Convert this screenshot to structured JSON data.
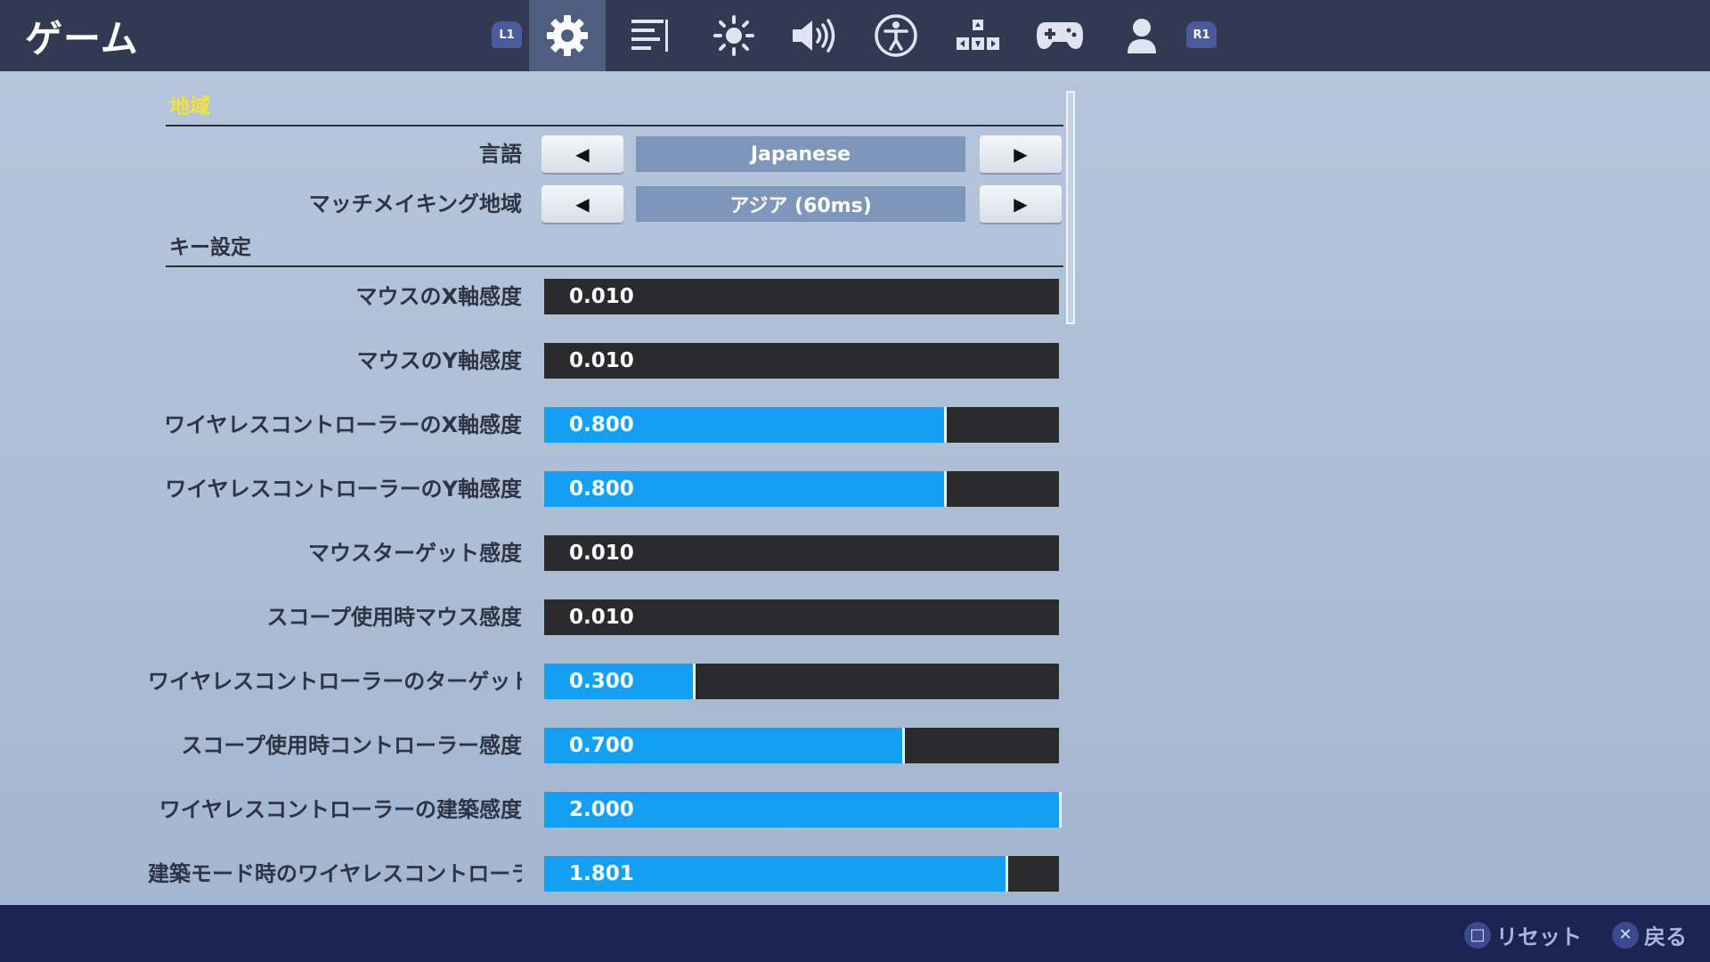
{
  "header": {
    "title": "ゲーム",
    "tabs": [
      {
        "icon": "l1-button-icon",
        "label": "L1"
      },
      {
        "icon": "gear-icon",
        "active": true
      },
      {
        "icon": "list-icon"
      },
      {
        "icon": "brightness-icon"
      },
      {
        "icon": "speaker-icon"
      },
      {
        "icon": "accessibility-icon"
      },
      {
        "icon": "input-keys-icon"
      },
      {
        "icon": "gamepad-icon"
      },
      {
        "icon": "user-icon"
      },
      {
        "icon": "r1-button-icon",
        "label": "R1"
      }
    ]
  },
  "sections": {
    "region": "地域",
    "keys": "キー設定"
  },
  "language": {
    "label": "言語",
    "value": "Japanese"
  },
  "matchmaking": {
    "label": "マッチメイキング地域",
    "value": "アジア (60ms)"
  },
  "sliders": [
    {
      "label": "マウスのX軸感度",
      "value": "0.010",
      "fraction": 0.0
    },
    {
      "label": "マウスのY軸感度",
      "value": "0.010",
      "fraction": 0.0
    },
    {
      "label": "ワイヤレスコントローラーのX軸感度",
      "value": "0.800",
      "fraction": 0.776
    },
    {
      "label": "ワイヤレスコントローラーのY軸感度",
      "value": "0.800",
      "fraction": 0.776
    },
    {
      "label": "マウスターゲット感度",
      "value": "0.010",
      "fraction": 0.0
    },
    {
      "label": "スコープ使用時マウス感度",
      "value": "0.010",
      "fraction": 0.0
    },
    {
      "label": "ワイヤレスコントローラーのターゲット感度",
      "value": "0.300",
      "fraction": 0.289
    },
    {
      "label": "スコープ使用時コントローラー感度",
      "value": "0.700",
      "fraction": 0.695
    },
    {
      "label": "ワイヤレスコントローラーの建築感度",
      "value": "2.000",
      "fraction": 1.0
    },
    {
      "label": "建築モード時のワイヤレスコントローラー感度",
      "value": "1.801",
      "fraction": 0.896
    }
  ],
  "footer": {
    "reset": "リセット",
    "back": "戻る"
  },
  "colors": {
    "accent_fill": "#13a0f3",
    "section_highlight": "#f3e23a",
    "topbar": "#313a52",
    "bottombar": "#1b2452"
  }
}
